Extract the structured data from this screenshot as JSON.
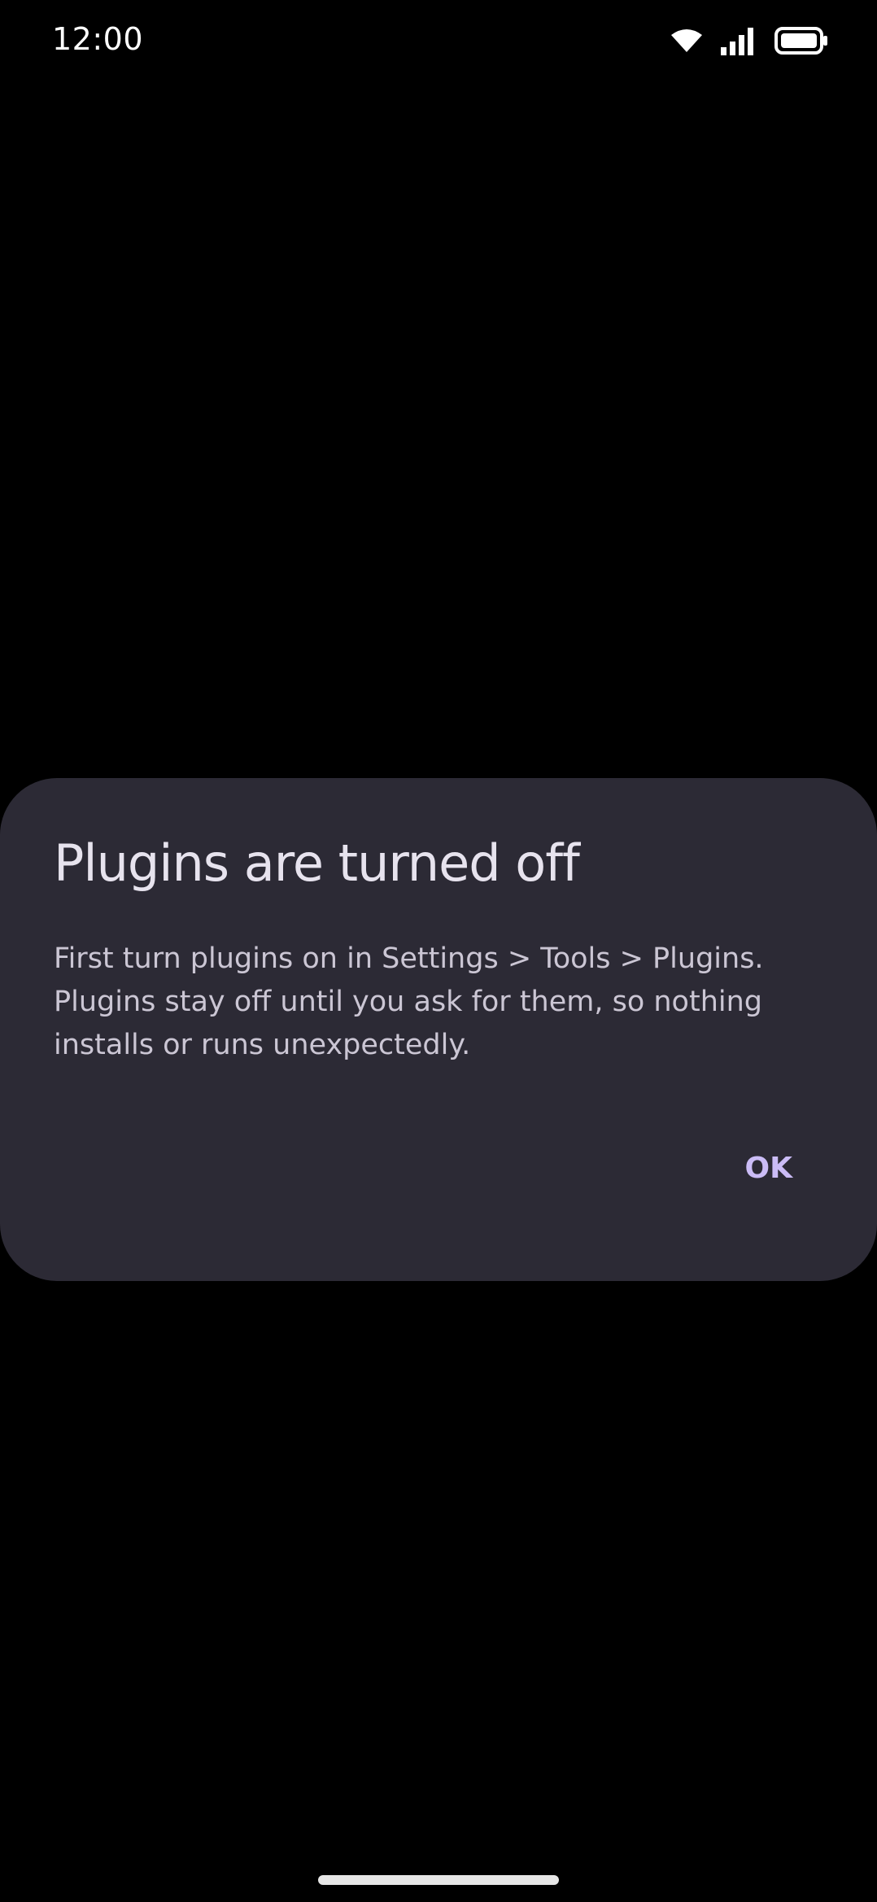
{
  "status_bar": {
    "time": "12:00",
    "icons": [
      "wifi-icon",
      "signal-icon",
      "battery-icon"
    ]
  },
  "dialog": {
    "title": "Plugins are turned off",
    "message": "First turn plugins on in Settings > Tools > Plugins. Plugins stay off until you ask for them, so nothing installs or runs unexpectedly.",
    "ok_label": "OK"
  },
  "colors": {
    "background": "#000000",
    "dialog_surface": "#2c2a35",
    "title_text": "#e7e3ee",
    "body_text": "#cbc6d4",
    "accent": "#cbbcf6"
  }
}
